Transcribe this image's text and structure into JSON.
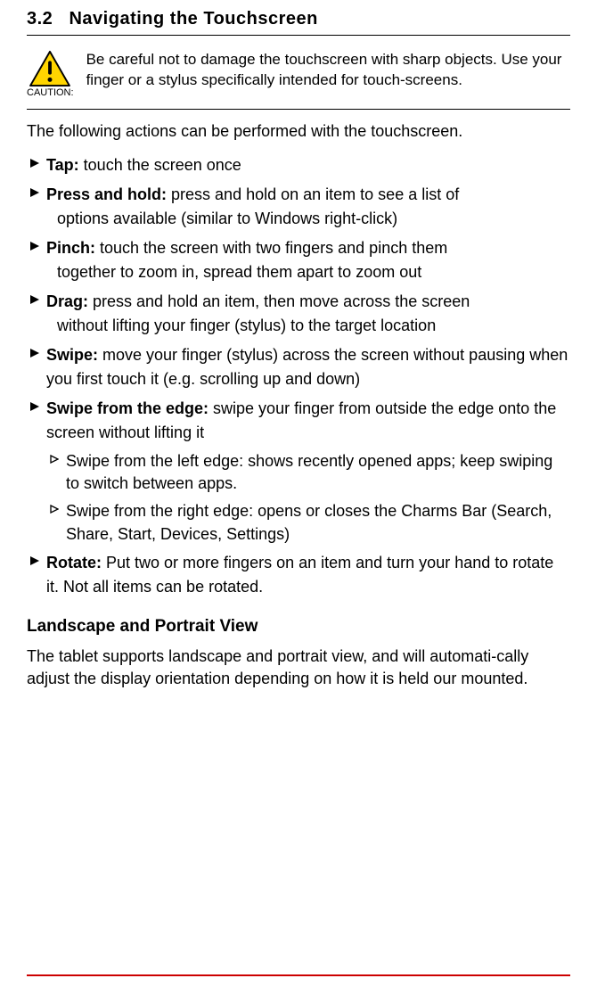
{
  "section": {
    "number": "3.2",
    "title": "Navigating the Touchscreen"
  },
  "caution": {
    "label": "CAUTION:",
    "text": "Be careful not to damage the touchscreen with sharp objects. Use your finger or a stylus specifically intended for touch-screens."
  },
  "intro": "The following actions can be performed with the touchscreen.",
  "items": [
    {
      "bold": "Tap:",
      "rest": " touch the screen once"
    },
    {
      "bold": "Press and hold:",
      "rest": " press and hold on an item to see a list of",
      "cont": "options available (similar to Windows right-click)"
    },
    {
      "bold": "Pinch:",
      "rest": " touch the screen with two fingers and pinch them",
      "cont": " together to zoom in, spread them apart to zoom out"
    },
    {
      "bold": "Drag:",
      "rest": " press and hold an item, then move across the screen",
      "cont": "without lifting your finger (stylus) to the target location"
    },
    {
      "bold": "Swipe:",
      "rest": " move your finger (stylus) across the screen without pausing when you first touch it (e.g. scrolling up and down)"
    },
    {
      "bold": "Swipe from the edge:",
      "rest": " swipe your finger from outside the edge onto the screen without lifting it",
      "subs": [
        "Swipe from the left edge: shows recently opened apps; keep swiping to switch between apps.",
        "Swipe from the right edge: opens or closes the Charms Bar (Search, Share, Start, Devices, Settings)"
      ]
    },
    {
      "bold": "Rotate:",
      "rest": " Put two or more fingers on an item and turn your hand to rotate it. Not all items can be rotated."
    }
  ],
  "subheading": "Landscape and Portrait View",
  "body": "The tablet supports landscape and portrait view, and will automati-cally adjust the display orientation depending on how it is held our mounted."
}
